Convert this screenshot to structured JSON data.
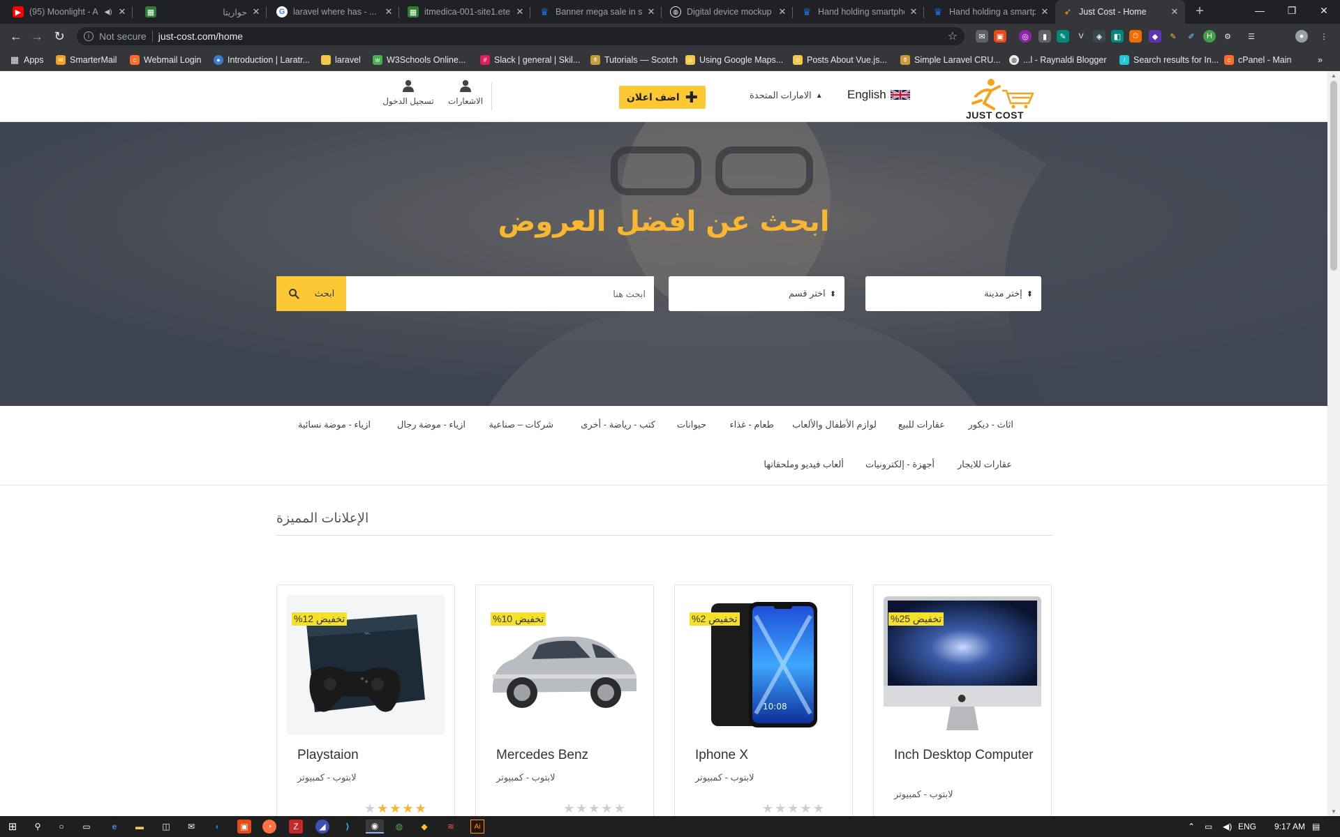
{
  "browser": {
    "tabs": [
      {
        "title": "(95) Moonlight - A",
        "favicon_color": "#ff0000"
      },
      {
        "title": "حواريتا",
        "favicon_color": "#2e7d32"
      },
      {
        "title": "laravel where has - ...",
        "favicon_color": "#4285f4"
      },
      {
        "title": "itmedica-001-site1.ete",
        "favicon_color": "#2e7d32"
      },
      {
        "title": "Banner mega sale in sm",
        "favicon_color": "#1a73e8"
      },
      {
        "title": "Digital device mockup",
        "favicon_color": "#e8eaed"
      },
      {
        "title": "Hand holding smartphc",
        "favicon_color": "#1a73e8"
      },
      {
        "title": "Hand holding a smartp",
        "favicon_color": "#1a73e8"
      },
      {
        "title": "Just Cost - Home",
        "favicon_color": "#f7a21b",
        "active": true
      }
    ],
    "address": {
      "security": "Not secure",
      "url": "just-cost.com/home"
    },
    "bookmarks": [
      {
        "label": "Apps",
        "color": "#888"
      },
      {
        "label": "SmarterMail",
        "color": "#f0a020"
      },
      {
        "label": "Webmail Login",
        "color": "#ff6c2c"
      },
      {
        "label": "Introduction | Laratr...",
        "color": "#3a7bd5"
      },
      {
        "label": "laravel",
        "color": "#f2c94c"
      },
      {
        "label": "W3Schools Online...",
        "color": "#4caf50"
      },
      {
        "label": "Slack | general | Skil...",
        "color": "#e01e5a"
      },
      {
        "label": "Tutorials — Scotch",
        "color": "#c89b3c"
      },
      {
        "label": "Using Google Maps...",
        "color": "#f2c94c"
      },
      {
        "label": "Posts About Vue.js...",
        "color": "#f2c94c"
      },
      {
        "label": "Simple Laravel CRU...",
        "color": "#c89b3c"
      },
      {
        "label": "...l - Raynaldi Blogger",
        "color": "#e8eaed"
      },
      {
        "label": "Search results for In...",
        "color": "#26c6da"
      },
      {
        "label": "cPanel - Main",
        "color": "#ff6c2c"
      }
    ]
  },
  "header": {
    "logo_text": "JUST COST",
    "language": "English",
    "country": "الامارات المتحدة",
    "post_ad": "اضف اعلان",
    "notifications": "الاشعارات",
    "login": "تسجيل الدخول"
  },
  "hero": {
    "title": "ابحث عن افضل العروض",
    "city_select": "إختر مدينة",
    "category_select": "اختر قسم",
    "search_placeholder": "ابحث هنا",
    "search_button": "ابحث"
  },
  "categories": [
    "اثاث - ديكور",
    "عقارات للبيع",
    "لوازم الأطفال والألعاب",
    "طعام - غذاء",
    "حيوانات",
    "كتب - رياضة - أخرى",
    "شركات – صناعية",
    "ازياء - موضة رجال",
    "ازياء - موضة نسائية",
    "عقارات للايجار",
    "أجهزة - إلكترونيات",
    "ألعاب فيديو وملحقاتها"
  ],
  "featured": {
    "title": "الإعلانات المميزة",
    "items": [
      {
        "name": "Inch Desktop Computer",
        "category": "لابتوب - كمبيوتر",
        "discount": "تخفيض 25%",
        "rating": 0
      },
      {
        "name": "Iphone X",
        "category": "لابتوب - كمبيوتر",
        "discount": "تخفيض 2%",
        "rating": 0
      },
      {
        "name": "Mercedes Benz",
        "category": "لابتوب - كمبيوتر",
        "discount": "تخفيض 10%",
        "rating": 0
      },
      {
        "name": "Playstaion",
        "category": "لابتوب - كمبيوتر",
        "discount": "تخفيض 12%",
        "rating": 4
      }
    ]
  },
  "taskbar": {
    "language": "ENG",
    "time": "9:17 AM"
  },
  "colors": {
    "accent": "#fcc935",
    "hero_title": "#f7b731",
    "discount_badge": "#f5e12a",
    "star_on": "#f7b731",
    "star_off": "#cfcfcf"
  }
}
